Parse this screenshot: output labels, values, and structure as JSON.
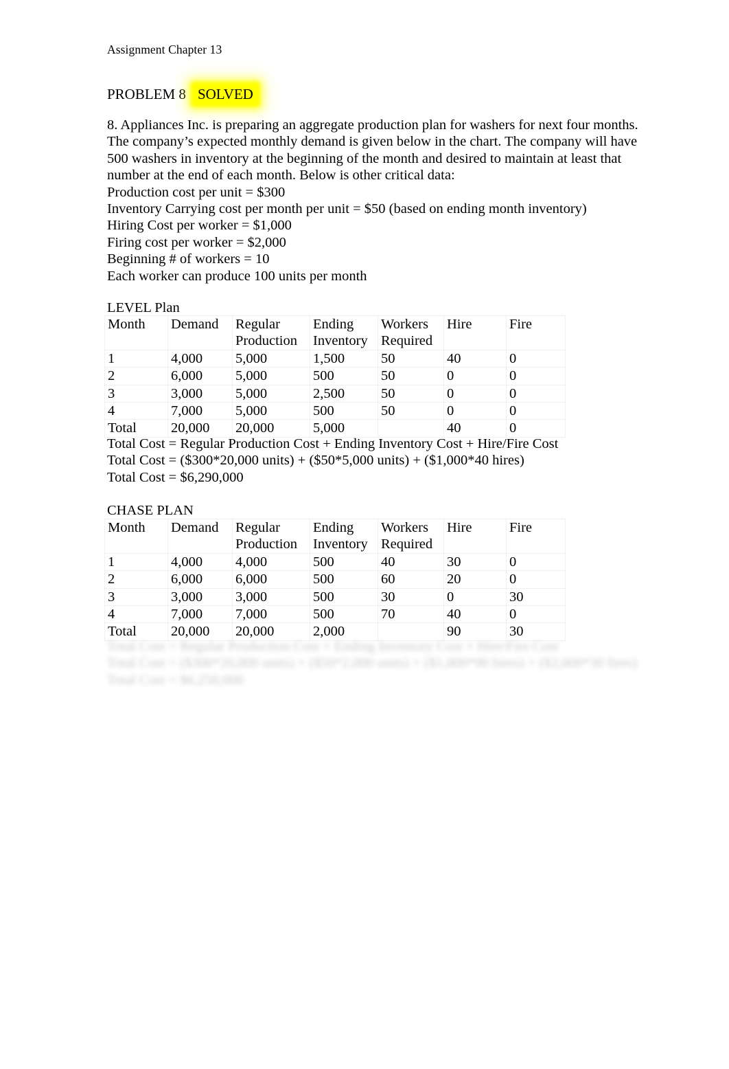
{
  "document": {
    "header": "Assignment Chapter 13",
    "title_main": "PROBLEM 8",
    "title_badge": "SOLVED"
  },
  "problem": {
    "paragraph_lines": [
      "8. Appliances Inc. is preparing an aggregate production plan for washers for next four months.",
      "The company’s expected monthly demand is given below in the chart.  The company will have",
      "500 washers in inventory at the beginning of the month and desired to maintain at least that",
      "number at the end of each month.  Below is other critical data:",
      "Production cost per unit = $300",
      "Inventory Carrying cost per month per unit = $50 (based on ending month inventory)",
      "Hiring Cost per worker = $1,000",
      "Firing cost per worker = $2,000",
      "Beginning # of workers = 10",
      "Each worker can produce 100 units per month"
    ]
  },
  "level_plan": {
    "label": "LEVEL Plan",
    "columns": [
      {
        "line1": "Month",
        "line2": ""
      },
      {
        "line1": "Demand",
        "line2": ""
      },
      {
        "line1": "Regular",
        "line2": "Production"
      },
      {
        "line1": "Ending",
        "line2": "Inventory"
      },
      {
        "line1": "Workers",
        "line2": "Required"
      },
      {
        "line1": "Hire",
        "line2": ""
      },
      {
        "line1": "Fire",
        "line2": ""
      }
    ],
    "rows": [
      [
        "1",
        "4,000",
        "5,000",
        "1,500",
        "50",
        "40",
        "0"
      ],
      [
        "2",
        "6,000",
        "5,000",
        "500",
        "50",
        "0",
        "0"
      ],
      [
        "3",
        "3,000",
        "5,000",
        "2,500",
        "50",
        "0",
        "0"
      ],
      [
        "4",
        "7,000",
        "5,000",
        "500",
        "50",
        "0",
        "0"
      ],
      [
        "Total",
        "20,000",
        "20,000",
        "5,000",
        "",
        "40",
        "0"
      ]
    ],
    "cost_lines": [
      "Total Cost = Regular Production Cost + Ending Inventory Cost + Hire/Fire Cost",
      "Total Cost = ($300*20,000 units) + ($50*5,000 units) + ($1,000*40 hires)",
      "Total Cost = $6,290,000"
    ]
  },
  "chase_plan": {
    "label": "CHASE PLAN",
    "columns": [
      {
        "line1": "Month",
        "line2": ""
      },
      {
        "line1": "Demand",
        "line2": ""
      },
      {
        "line1": "Regular",
        "line2": "Production"
      },
      {
        "line1": "Ending",
        "line2": "Inventory"
      },
      {
        "line1": "Workers",
        "line2": "Required"
      },
      {
        "line1": "Hire",
        "line2": ""
      },
      {
        "line1": "Fire",
        "line2": ""
      }
    ],
    "rows": [
      [
        "1",
        "4,000",
        "4,000",
        "500",
        "40",
        "30",
        "0"
      ],
      [
        "2",
        "6,000",
        "6,000",
        "500",
        "60",
        "20",
        "0"
      ],
      [
        "3",
        "3,000",
        "3,000",
        "500",
        "30",
        "0",
        "30"
      ],
      [
        "4",
        "7,000",
        "7,000",
        "500",
        "70",
        "40",
        "0"
      ],
      [
        "Total",
        "20,000",
        "20,000",
        "2,000",
        "",
        "90",
        "30"
      ]
    ],
    "cost_lines": [
      "Total Cost = Regular Production Cost + Ending Inventory Cost + Hire/Fire Cost",
      "Total Cost = ($300*20,000 units) + ($50*2,000 units) + ($1,000*90 hires) + ($2,000*30 fires)",
      "Total Cost = $6,250,000"
    ]
  }
}
